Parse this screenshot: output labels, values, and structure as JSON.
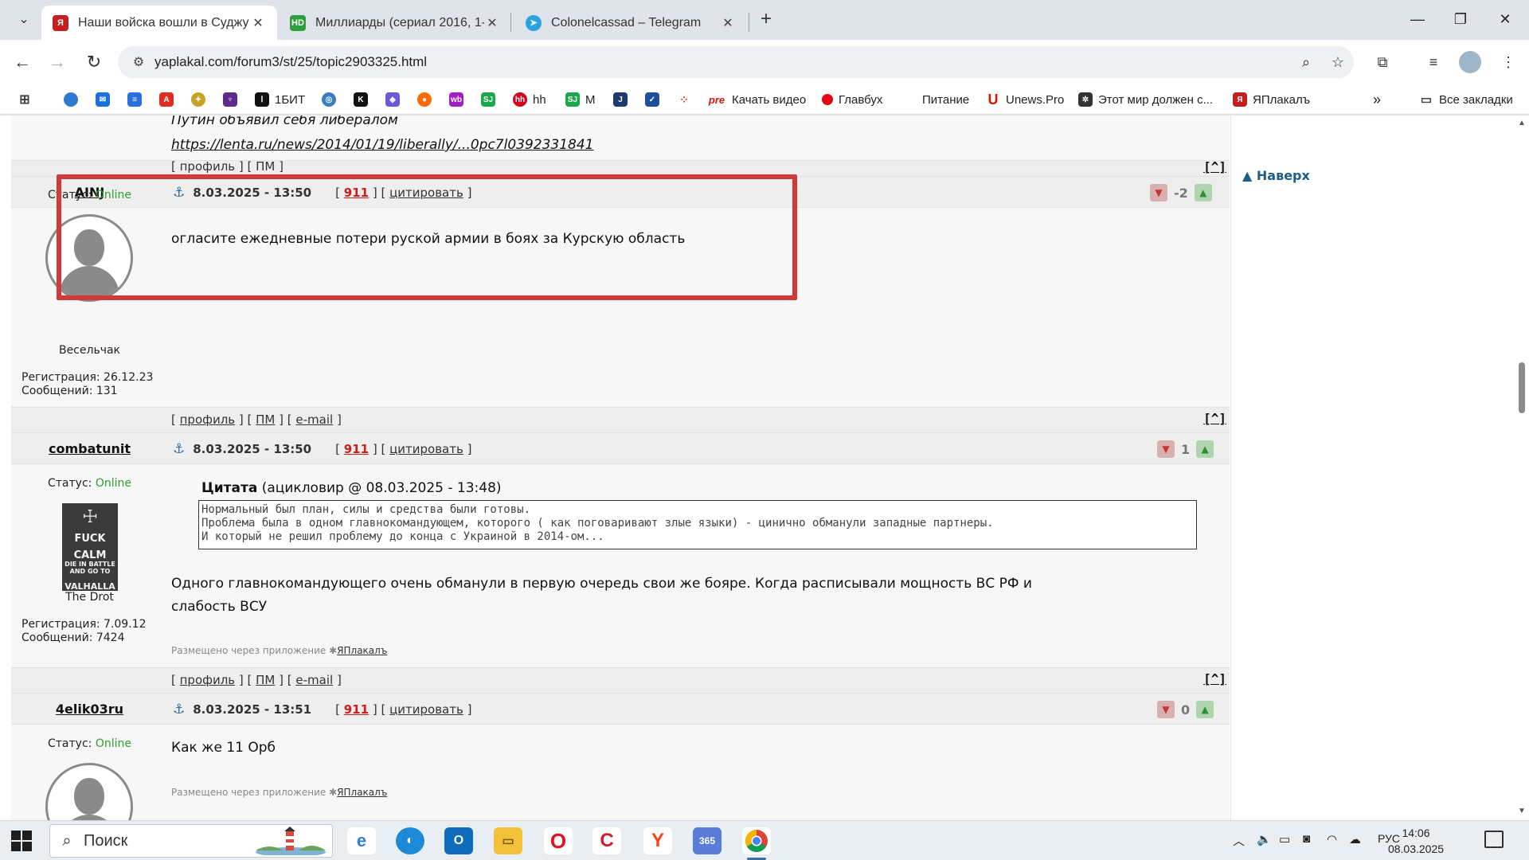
{
  "browser": {
    "tabs": [
      {
        "title": "Наши войска вошли в Суджу -",
        "favicon": "yaplakal-icon",
        "active": true
      },
      {
        "title": "Миллиарды (сериал 2016, 1-7",
        "favicon": "hd-icon",
        "active": false
      },
      {
        "title": "Colonelcassad – Telegram",
        "favicon": "telegram-icon",
        "active": false
      }
    ],
    "url": "yaplakal.com/forum3/st/25/topic2903325.html",
    "bookmarks": [
      {
        "label": "1БИТ"
      },
      {
        "label": "hh"
      },
      {
        "label": "M"
      },
      {
        "label": "Качать видео"
      },
      {
        "label": "Главбух"
      },
      {
        "label": "Питание"
      },
      {
        "label": "Unews.Pro"
      },
      {
        "label": "Этот мир должен с..."
      },
      {
        "label": "ЯПлакалъ"
      }
    ],
    "all_bookmarks_label": "Все закладки"
  },
  "forum": {
    "prev_post": {
      "text": "Путин объявил себя либералом",
      "link": "https://lenta.ru/news/2014/01/19/liberally/...0pc7l0392331841",
      "footer": "[ профиль ] [ ПМ ]"
    },
    "posts": [
      {
        "username": "AINJ",
        "date": "8.03.2025 - 13:50",
        "number": "911",
        "quote_label": "цитировать",
        "rating": "-2",
        "status_label": "Статус:",
        "status_value": "Online",
        "rank": "Весельчак",
        "registration": "Регистрация: 26.12.23",
        "messages": "Сообщений: 131",
        "text": "огласите ежедневные потери руской армии в боях за Курскую область",
        "footer": {
          "profile": "профиль",
          "pm": "ПМ",
          "email": "e-mail"
        }
      },
      {
        "username": "combatunit",
        "date": "8.03.2025 - 13:50",
        "number": "911",
        "quote_label": "цитировать",
        "rating": "1",
        "status_label": "Статус:",
        "status_value": "Online",
        "rank": "The Drot",
        "avatar_text": [
          "FUCK",
          "CALM",
          "DIE IN BATTLE",
          "AND GO TO",
          "VALHALLA"
        ],
        "registration": "Регистрация: 7.09.12",
        "messages": "Сообщений: 7424",
        "quote_title": "Цитата",
        "quote_meta": "(ацикловир @ 08.03.2025 - 13:48)",
        "quote_lines": [
          "Нормальный был план, силы и средства были готовы.",
          "Проблема была в одном главнокомандующем, которого ( как поговаривают злые языки) - цинично обманули западные партнеры.",
          "И который не решил проблему до конца с Украиной в 2014-ом..."
        ],
        "text_lines": [
          "Одного главнокомандующего очень обманули в первую очередь свои же бояре. Когда расписывали мощность ВС РФ и",
          "слабость ВСУ"
        ],
        "via_label": "Размещено через приложение",
        "via_app": "ЯПлакалъ",
        "footer": {
          "profile": "профиль",
          "pm": "ПМ",
          "email": "e-mail"
        }
      },
      {
        "username": "4elik03ru",
        "date": "8.03.2025 - 13:51",
        "number": "911",
        "quote_label": "цитировать",
        "rating": "0",
        "status_label": "Статус:",
        "status_value": "Online",
        "text": "Как же 11 Орб",
        "via_label": "Размещено через приложение",
        "via_app": "ЯПлакалъ"
      }
    ],
    "to_top": "[^]",
    "sidebar_top_link": "Наверх"
  },
  "taskbar": {
    "search_placeholder": "Поиск",
    "language": "РУС",
    "time": "14:06",
    "date": "08.03.2025"
  },
  "colors": {
    "online": "#2ea02e",
    "post_number": "#d21c1c",
    "highlight_box": "#d23a3a",
    "link_blue": "#1e5c8a"
  }
}
